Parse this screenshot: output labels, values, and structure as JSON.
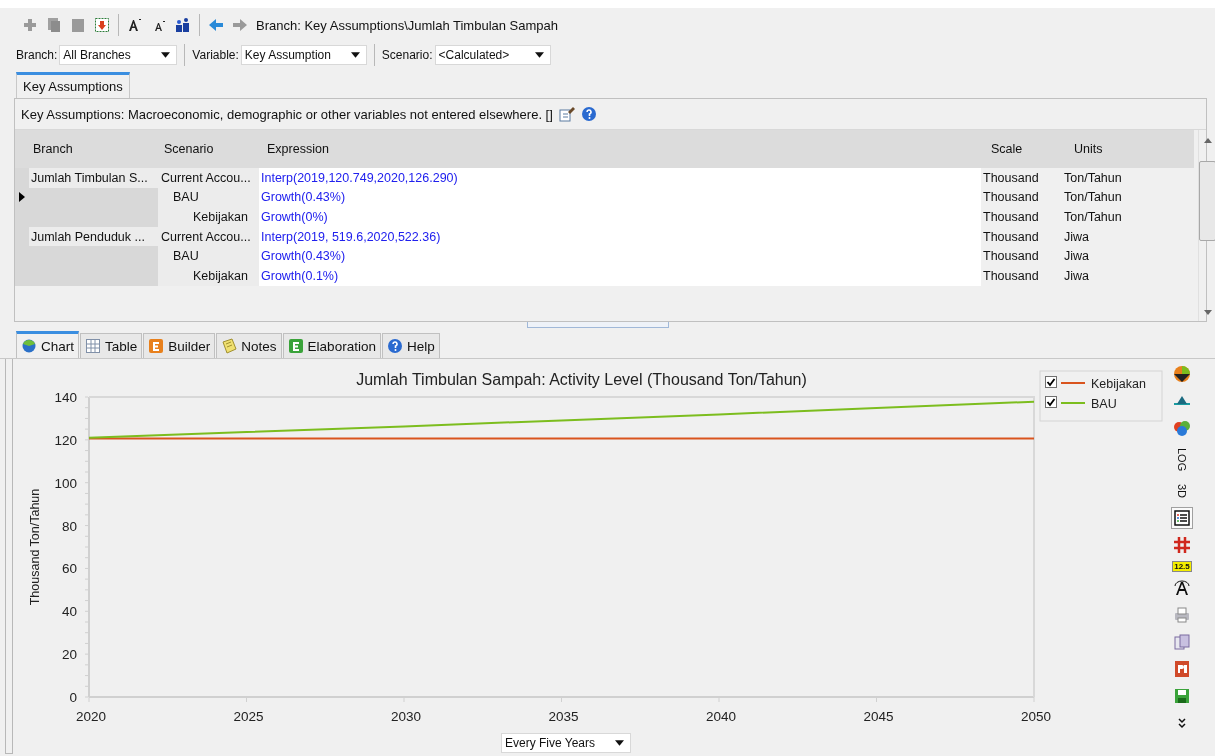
{
  "toolbar": {
    "breadcrumb": "Branch: Key Assumptions\\Jumlah Timbulan Sampah"
  },
  "selectors": [
    {
      "label": "Branch:",
      "value": "All Branches"
    },
    {
      "label": "Variable:",
      "value": "Key Assumption"
    },
    {
      "label": "Scenario:",
      "value": "<Calculated>"
    }
  ],
  "top_tabs": [
    {
      "label": "Key Assumptions",
      "selected": true
    }
  ],
  "description": "Key Assumptions: Macroeconomic, demographic or other variables not entered elsewhere. []",
  "table": {
    "columns": [
      "Branch",
      "Scenario",
      "Expression",
      "Scale",
      "Units"
    ],
    "rows": [
      {
        "branch": "Jumlah Timbulan S...",
        "scenarios": [
          {
            "name": "Current Accou...",
            "expression": "Interp(2019,120.749,2020,126.290)",
            "scale": "Thousand",
            "units": "Ton/Tahun",
            "selected": false,
            "children": [
              {
                "name": "BAU",
                "expression": "Growth(0.43%)",
                "scale": "Thousand",
                "units": "Ton/Tahun",
                "selected": true,
                "children": [
                  {
                    "name": "Kebijakan",
                    "expression": "Growth(0%)",
                    "scale": "Thousand",
                    "units": "Ton/Tahun",
                    "selected": false
                  }
                ]
              }
            ]
          }
        ]
      },
      {
        "branch": "Jumlah Penduduk ...",
        "scenarios": [
          {
            "name": "Current Accou...",
            "expression": "Interp(2019, 519.6,2020,522.36)",
            "scale": "Thousand",
            "units": "Jiwa",
            "selected": false,
            "children": [
              {
                "name": "BAU",
                "expression": "Growth(0.43%)",
                "scale": "Thousand",
                "units": "Jiwa",
                "selected": false,
                "children": [
                  {
                    "name": "Kebijakan",
                    "expression": "Growth(0.1%)",
                    "scale": "Thousand",
                    "units": "Jiwa",
                    "selected": false
                  }
                ]
              }
            ]
          }
        ]
      }
    ]
  },
  "bottom_tabs": [
    {
      "label": "Chart",
      "kind": "chart",
      "selected": true
    },
    {
      "label": "Table",
      "kind": "table",
      "selected": false
    },
    {
      "label": "Builder",
      "kind": "builder",
      "selected": false
    },
    {
      "label": "Notes",
      "kind": "notes",
      "selected": false
    },
    {
      "label": "Elaboration",
      "kind": "elaboration",
      "selected": false
    },
    {
      "label": "Help",
      "kind": "help",
      "selected": false
    }
  ],
  "chart": {
    "chart_data": {
      "type": "line",
      "title": "Jumlah Timbulan Sampah: Activity Level (Thousand Ton/Tahun)",
      "ylabel": "Thousand Ton/Tahun",
      "x": [
        2020,
        2025,
        2030,
        2035,
        2040,
        2045,
        2050
      ],
      "series": [
        {
          "name": "Kebijakan",
          "color": "#d9541e",
          "values": [
            120.7,
            120.7,
            120.7,
            120.7,
            120.7,
            120.7,
            120.7
          ]
        },
        {
          "name": "BAU",
          "color": "#7cbd1e",
          "values": [
            121,
            123.6,
            126.3,
            129.1,
            131.9,
            134.8,
            137.8
          ]
        }
      ],
      "legend": "upper right",
      "xlim": [
        2020,
        2050
      ],
      "ylim": [
        0,
        140
      ],
      "xticks": [
        2020,
        2025,
        2030,
        2035,
        2040,
        2045,
        2050
      ],
      "yticks": [
        0,
        20,
        40,
        60,
        80,
        100,
        120,
        140
      ]
    },
    "legend_checks": [
      {
        "checked": true
      },
      {
        "checked": true
      }
    ],
    "interval": "Every Five Years"
  },
  "tools": [
    {
      "kind": "pie",
      "selected": false
    },
    {
      "kind": "axis",
      "selected": false
    },
    {
      "kind": "colors",
      "selected": false
    },
    {
      "kind": "text",
      "label": "LOG",
      "selected": false
    },
    {
      "kind": "text",
      "label": "3D",
      "selected": false
    },
    {
      "kind": "legend",
      "selected": true
    },
    {
      "kind": "grid",
      "selected": false
    },
    {
      "kind": "number",
      "label": "12.5",
      "selected": false
    },
    {
      "kind": "font",
      "selected": false
    },
    {
      "kind": "print",
      "selected": false
    },
    {
      "kind": "copy",
      "selected": false
    },
    {
      "kind": "ppt",
      "selected": false
    },
    {
      "kind": "save",
      "selected": false
    },
    {
      "kind": "more",
      "selected": false
    }
  ]
}
